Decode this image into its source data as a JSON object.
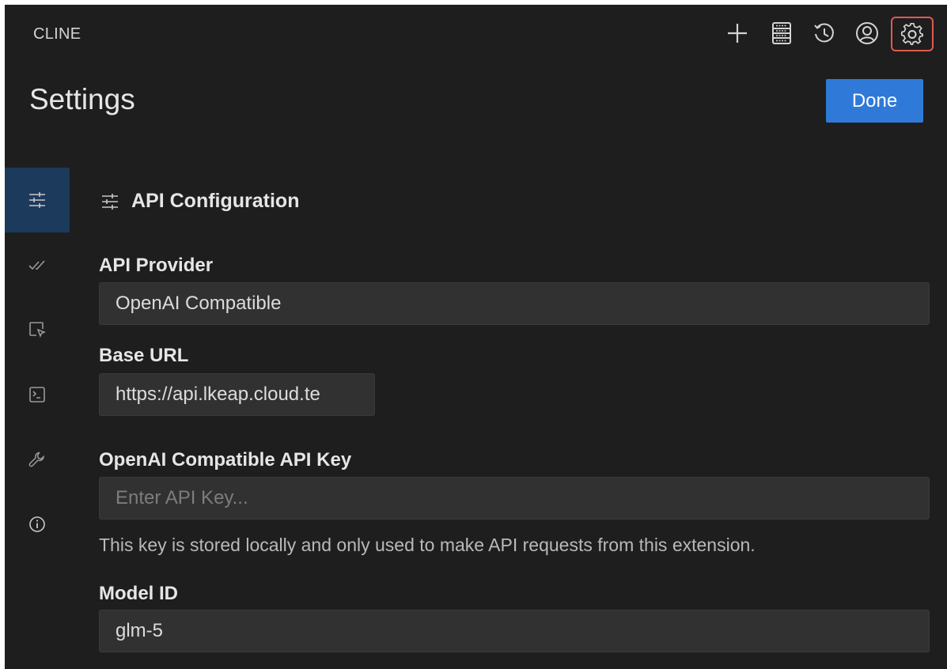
{
  "header": {
    "app_title": "CLINE",
    "icons": [
      "plus-icon",
      "server-icon",
      "history-icon",
      "account-icon",
      "gear-icon"
    ],
    "highlight_color": "#e05a4f"
  },
  "settings": {
    "title": "Settings",
    "done_label": "Done"
  },
  "sidebar": {
    "items": [
      {
        "icon": "sliders-icon",
        "active": true
      },
      {
        "icon": "check-double-icon"
      },
      {
        "icon": "browser-cursor-icon"
      },
      {
        "icon": "terminal-icon"
      },
      {
        "icon": "wrench-icon"
      },
      {
        "icon": "info-icon"
      }
    ],
    "active_color": "#1c3a5c"
  },
  "api_config": {
    "section_title": "API Configuration",
    "provider_label": "API Provider",
    "provider_value": "OpenAI Compatible",
    "base_url_label": "Base URL",
    "base_url_value": "https://api.lkeap.cloud.te",
    "api_key_label": "OpenAI Compatible API Key",
    "api_key_placeholder": "Enter API Key...",
    "api_key_hint": "This key is stored locally and only used to make API requests from this extension.",
    "model_id_label": "Model ID",
    "model_id_value": "glm-5"
  },
  "colors": {
    "accent": "#2f7ad8",
    "background": "#1e1e1e"
  }
}
